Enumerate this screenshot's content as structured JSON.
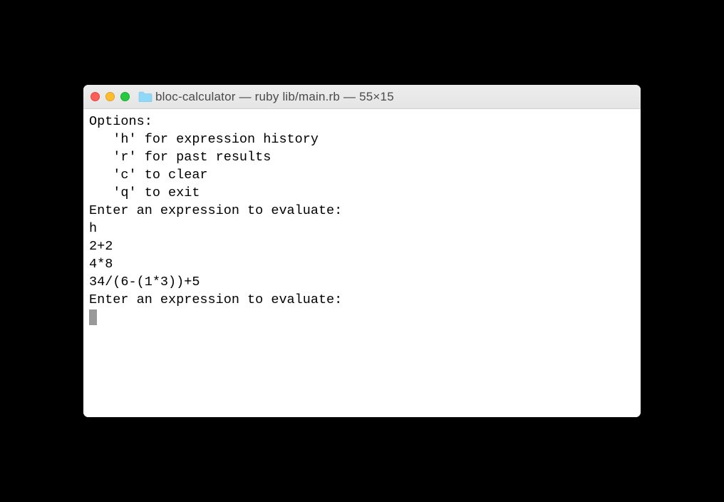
{
  "window": {
    "title": "bloc-calculator — ruby lib/main.rb — 55×15"
  },
  "terminal": {
    "lines": [
      "Options:",
      "   'h' for expression history",
      "   'r' for past results",
      "   'c' to clear",
      "   'q' to exit",
      "Enter an expression to evaluate:",
      "h",
      "2+2",
      "4*8",
      "34/(6-(1*3))+5",
      "Enter an expression to evaluate:"
    ]
  },
  "colors": {
    "close": "#ff5f56",
    "minimize": "#ffbd2e",
    "maximize": "#27c93f",
    "folder": "#8fd8f7"
  }
}
